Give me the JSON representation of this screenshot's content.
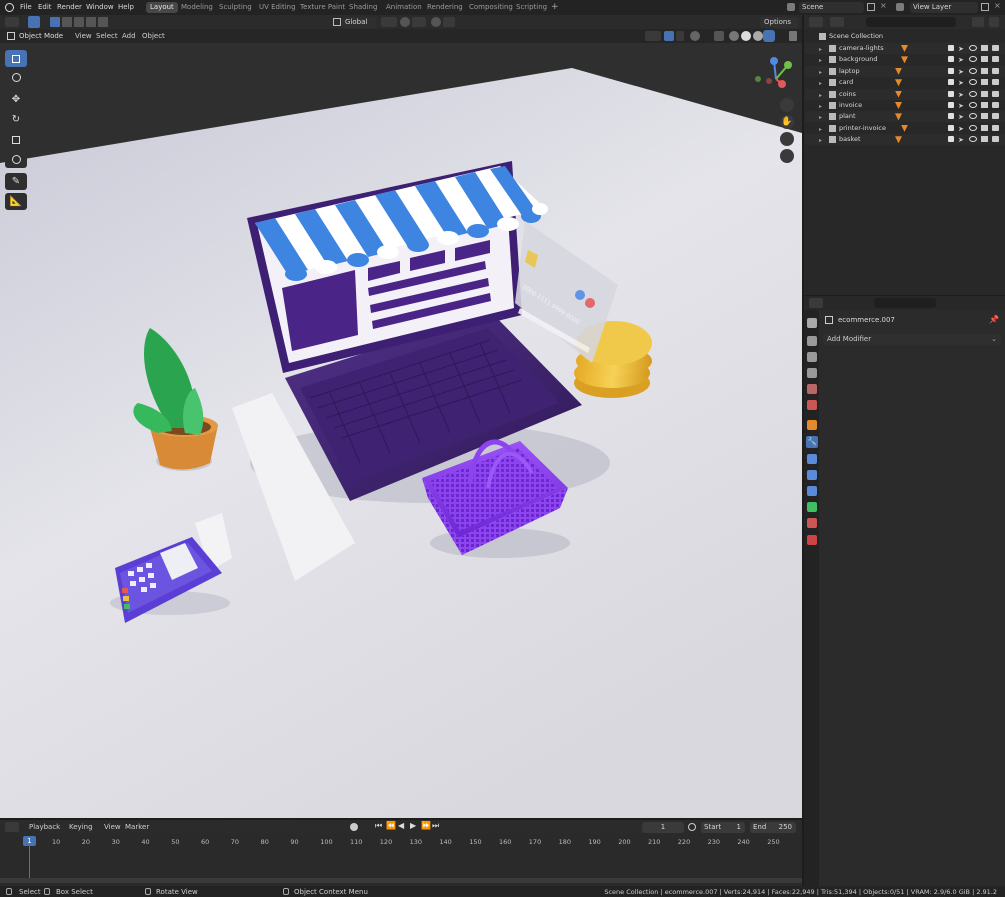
{
  "menu": [
    "File",
    "Edit",
    "Render",
    "Window",
    "Help"
  ],
  "workspaces": [
    "Layout",
    "Modeling",
    "Sculpting",
    "UV Editing",
    "Texture Paint",
    "Shading",
    "Animation",
    "Rendering",
    "Compositing",
    "Scripting"
  ],
  "active_workspace": "Layout",
  "scene_name": "Scene",
  "view_layer": "View Layer",
  "header": {
    "orientation": "Global",
    "options_label": "Options",
    "mode": "Object Mode",
    "view_menu": [
      "View",
      "Select",
      "Add",
      "Object"
    ]
  },
  "outliner": {
    "root": "Scene Collection",
    "items": [
      "camera-lights",
      "background",
      "laptop",
      "card",
      "coins",
      "invoice",
      "plant",
      "printer-invoice",
      "basket"
    ]
  },
  "properties": {
    "object_name": "ecommerce.007",
    "add_modifier": "Add Modifier"
  },
  "timeline": {
    "menus": [
      "Playback",
      "Keying",
      "View",
      "Marker"
    ],
    "current_frame": "1",
    "start_label": "Start",
    "start_value": "1",
    "end_label": "End",
    "end_value": "250",
    "frame_marker": "1",
    "ticks": [
      "10",
      "20",
      "30",
      "40",
      "50",
      "60",
      "70",
      "80",
      "90",
      "100",
      "110",
      "120",
      "130",
      "140",
      "150",
      "160",
      "170",
      "180",
      "190",
      "200",
      "210",
      "220",
      "230",
      "240",
      "250"
    ]
  },
  "statusbar": {
    "select": "Select",
    "box_select": "Box Select",
    "rotate_view": "Rotate View",
    "context_menu": "Object Context Menu",
    "stats": "Scene Collection | ecommerce.007 | Verts:24,914 | Faces:22,949 | Tris:51,394 | Objects:0/51 | VRAM: 2.9/6.0 GiB | 2.91.2"
  },
  "card_digits": "0000 1111 9999 0000",
  "colors": {
    "accent": "#4772b3",
    "purple": "#3b1a6e",
    "basket": "#8a3ff0",
    "stripe_blue": "#3d85e0",
    "coin": "#e8b534",
    "plant": "#2aa44f",
    "pot": "#d98a36"
  }
}
